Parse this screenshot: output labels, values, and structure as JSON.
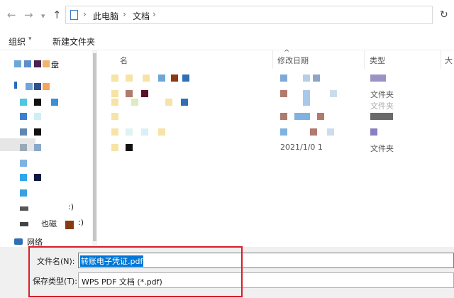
{
  "nav": {
    "back": "←",
    "forward": "→",
    "dropdown": "▾",
    "up": "↑",
    "refresh": "↻"
  },
  "address": {
    "crumbs": [
      "此电脑",
      "文档"
    ],
    "separator": "›"
  },
  "commandbar": {
    "organize": "组织",
    "organize_arrow": "▾",
    "new_folder": "新建文件夹"
  },
  "columns": {
    "name": "名",
    "modified": "修改日期",
    "type": "类型",
    "size": "大"
  },
  "navpane": {
    "disk": "盘",
    "drive1": ":)",
    "drive2": "也磁",
    "drive2b": ":)",
    "network": "网络"
  },
  "files": {
    "type_folder_1": "文件夹",
    "type_folder_2": "文件夹",
    "date_frag": "2021/1/0 1",
    "type_folder_3": "文件夹"
  },
  "save": {
    "filename_label": "文件名(N):",
    "filename_value": "转账电子凭证.pdf",
    "filetype_label": "保存类型(T):",
    "filetype_value": "WPS PDF 文档 (*.pdf)"
  },
  "colors": {
    "selection": "#0078d7",
    "highlight_box": "#d81f26"
  }
}
